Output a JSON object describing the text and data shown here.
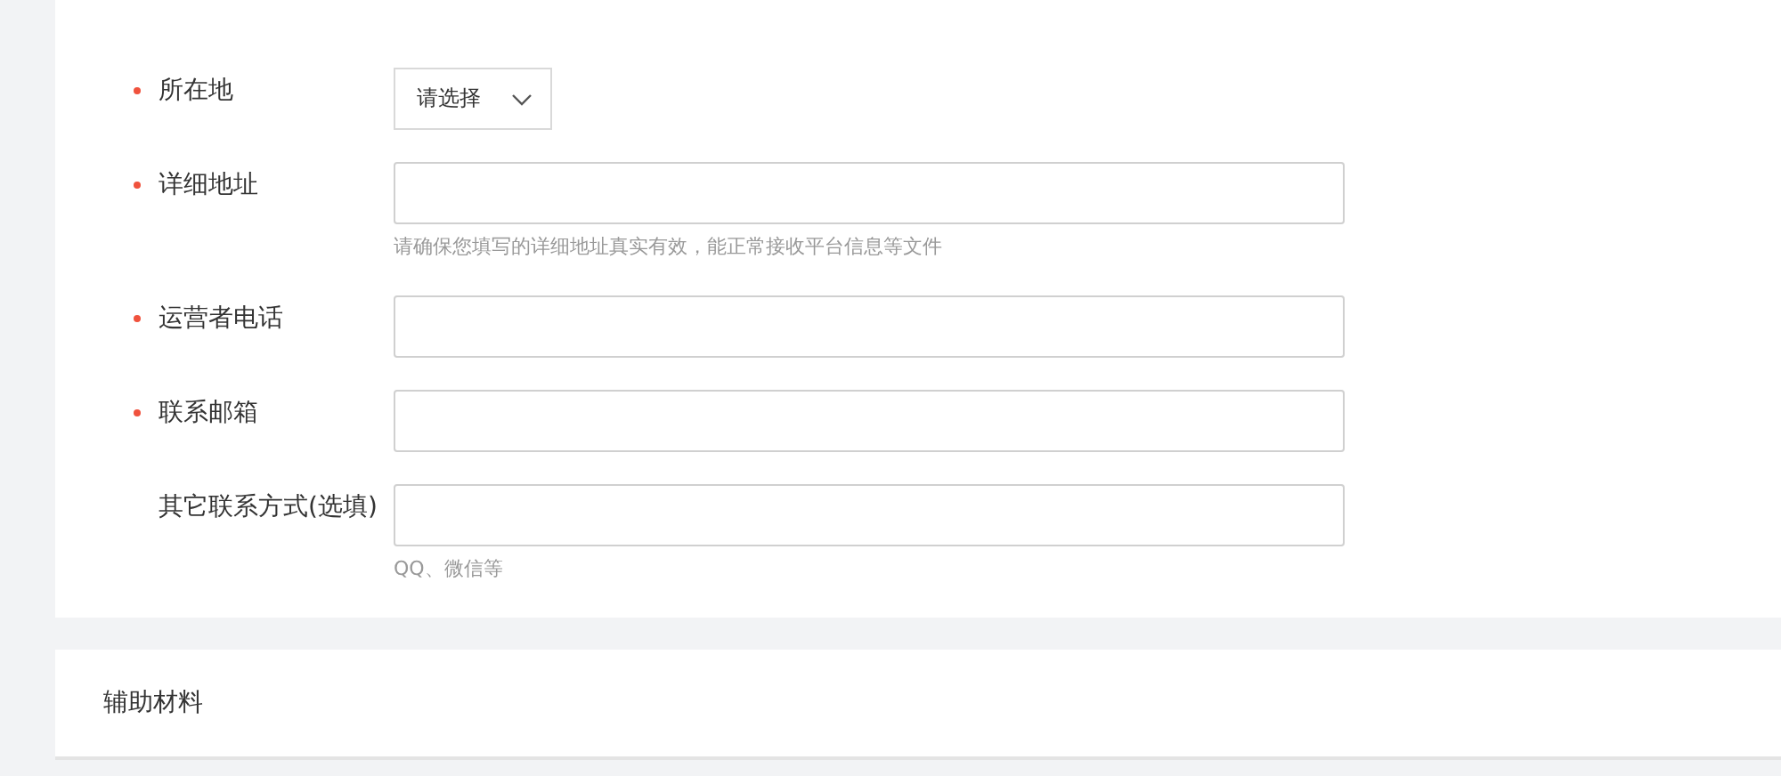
{
  "form": {
    "fields": [
      {
        "kind": "select",
        "required": true,
        "label": "所在地",
        "value": "请选择"
      },
      {
        "kind": "text",
        "required": true,
        "label": "详细地址",
        "hint": "请确保您填写的详细地址真实有效，能正常接收平台信息等文件"
      },
      {
        "kind": "text",
        "required": true,
        "label": "运营者电话"
      },
      {
        "kind": "text",
        "required": true,
        "label": "联系邮箱"
      },
      {
        "kind": "text",
        "required": false,
        "label": "其它联系方式(选填)",
        "hint": "QQ、微信等"
      }
    ]
  },
  "section": {
    "title": "辅助材料"
  }
}
